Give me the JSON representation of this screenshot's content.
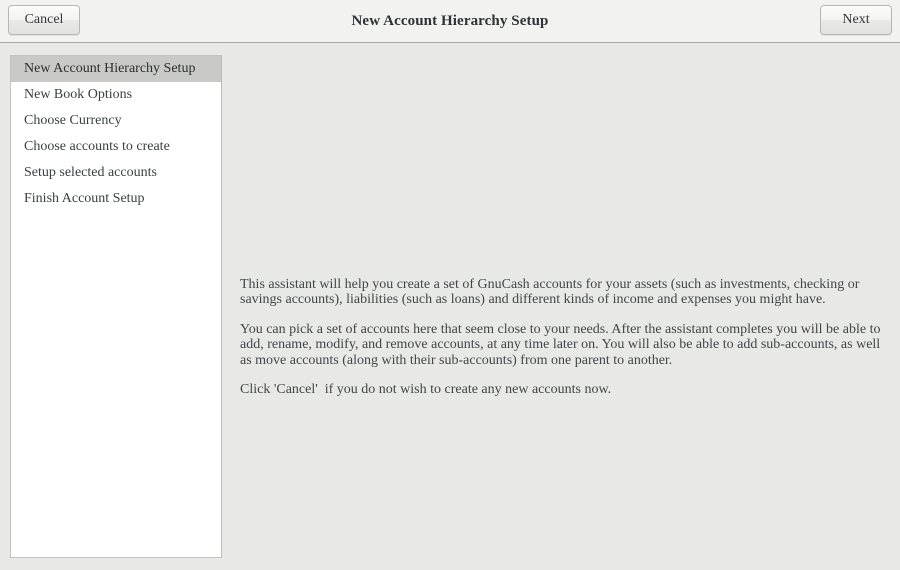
{
  "window": {
    "title": "New Account Hierarchy Setup",
    "background_color": "#e8e8e6",
    "header_color": "#f2f2f1"
  },
  "header": {
    "title": "New Account Hierarchy Setup",
    "cancel_label": "Cancel",
    "next_label": "Next"
  },
  "sidebar": {
    "selected_index": 0,
    "selected_color": "#c9c9c7",
    "items": [
      {
        "label": "New Account Hierarchy Setup",
        "selected": true
      },
      {
        "label": "New Book Options",
        "selected": false
      },
      {
        "label": "Choose Currency",
        "selected": false
      },
      {
        "label": "Choose accounts to create",
        "selected": false
      },
      {
        "label": "Setup selected accounts",
        "selected": false
      },
      {
        "label": "Finish Account Setup",
        "selected": false
      }
    ]
  },
  "content": {
    "paragraphs": [
      "This assistant will help you create a set of GnuCash accounts for your assets (such as investments, checking or savings accounts), liabilities (such as loans) and different kinds of income and expenses you might have.",
      "You can pick a set of accounts here that seem close to your needs. After the assistant completes you will be able to add, rename, modify, and remove accounts, at any time later on. You will also be able to add sub-accounts, as well as move accounts (along with their sub-accounts) from one parent to another.",
      "Click 'Cancel'  if you do not wish to create any new accounts now."
    ]
  }
}
